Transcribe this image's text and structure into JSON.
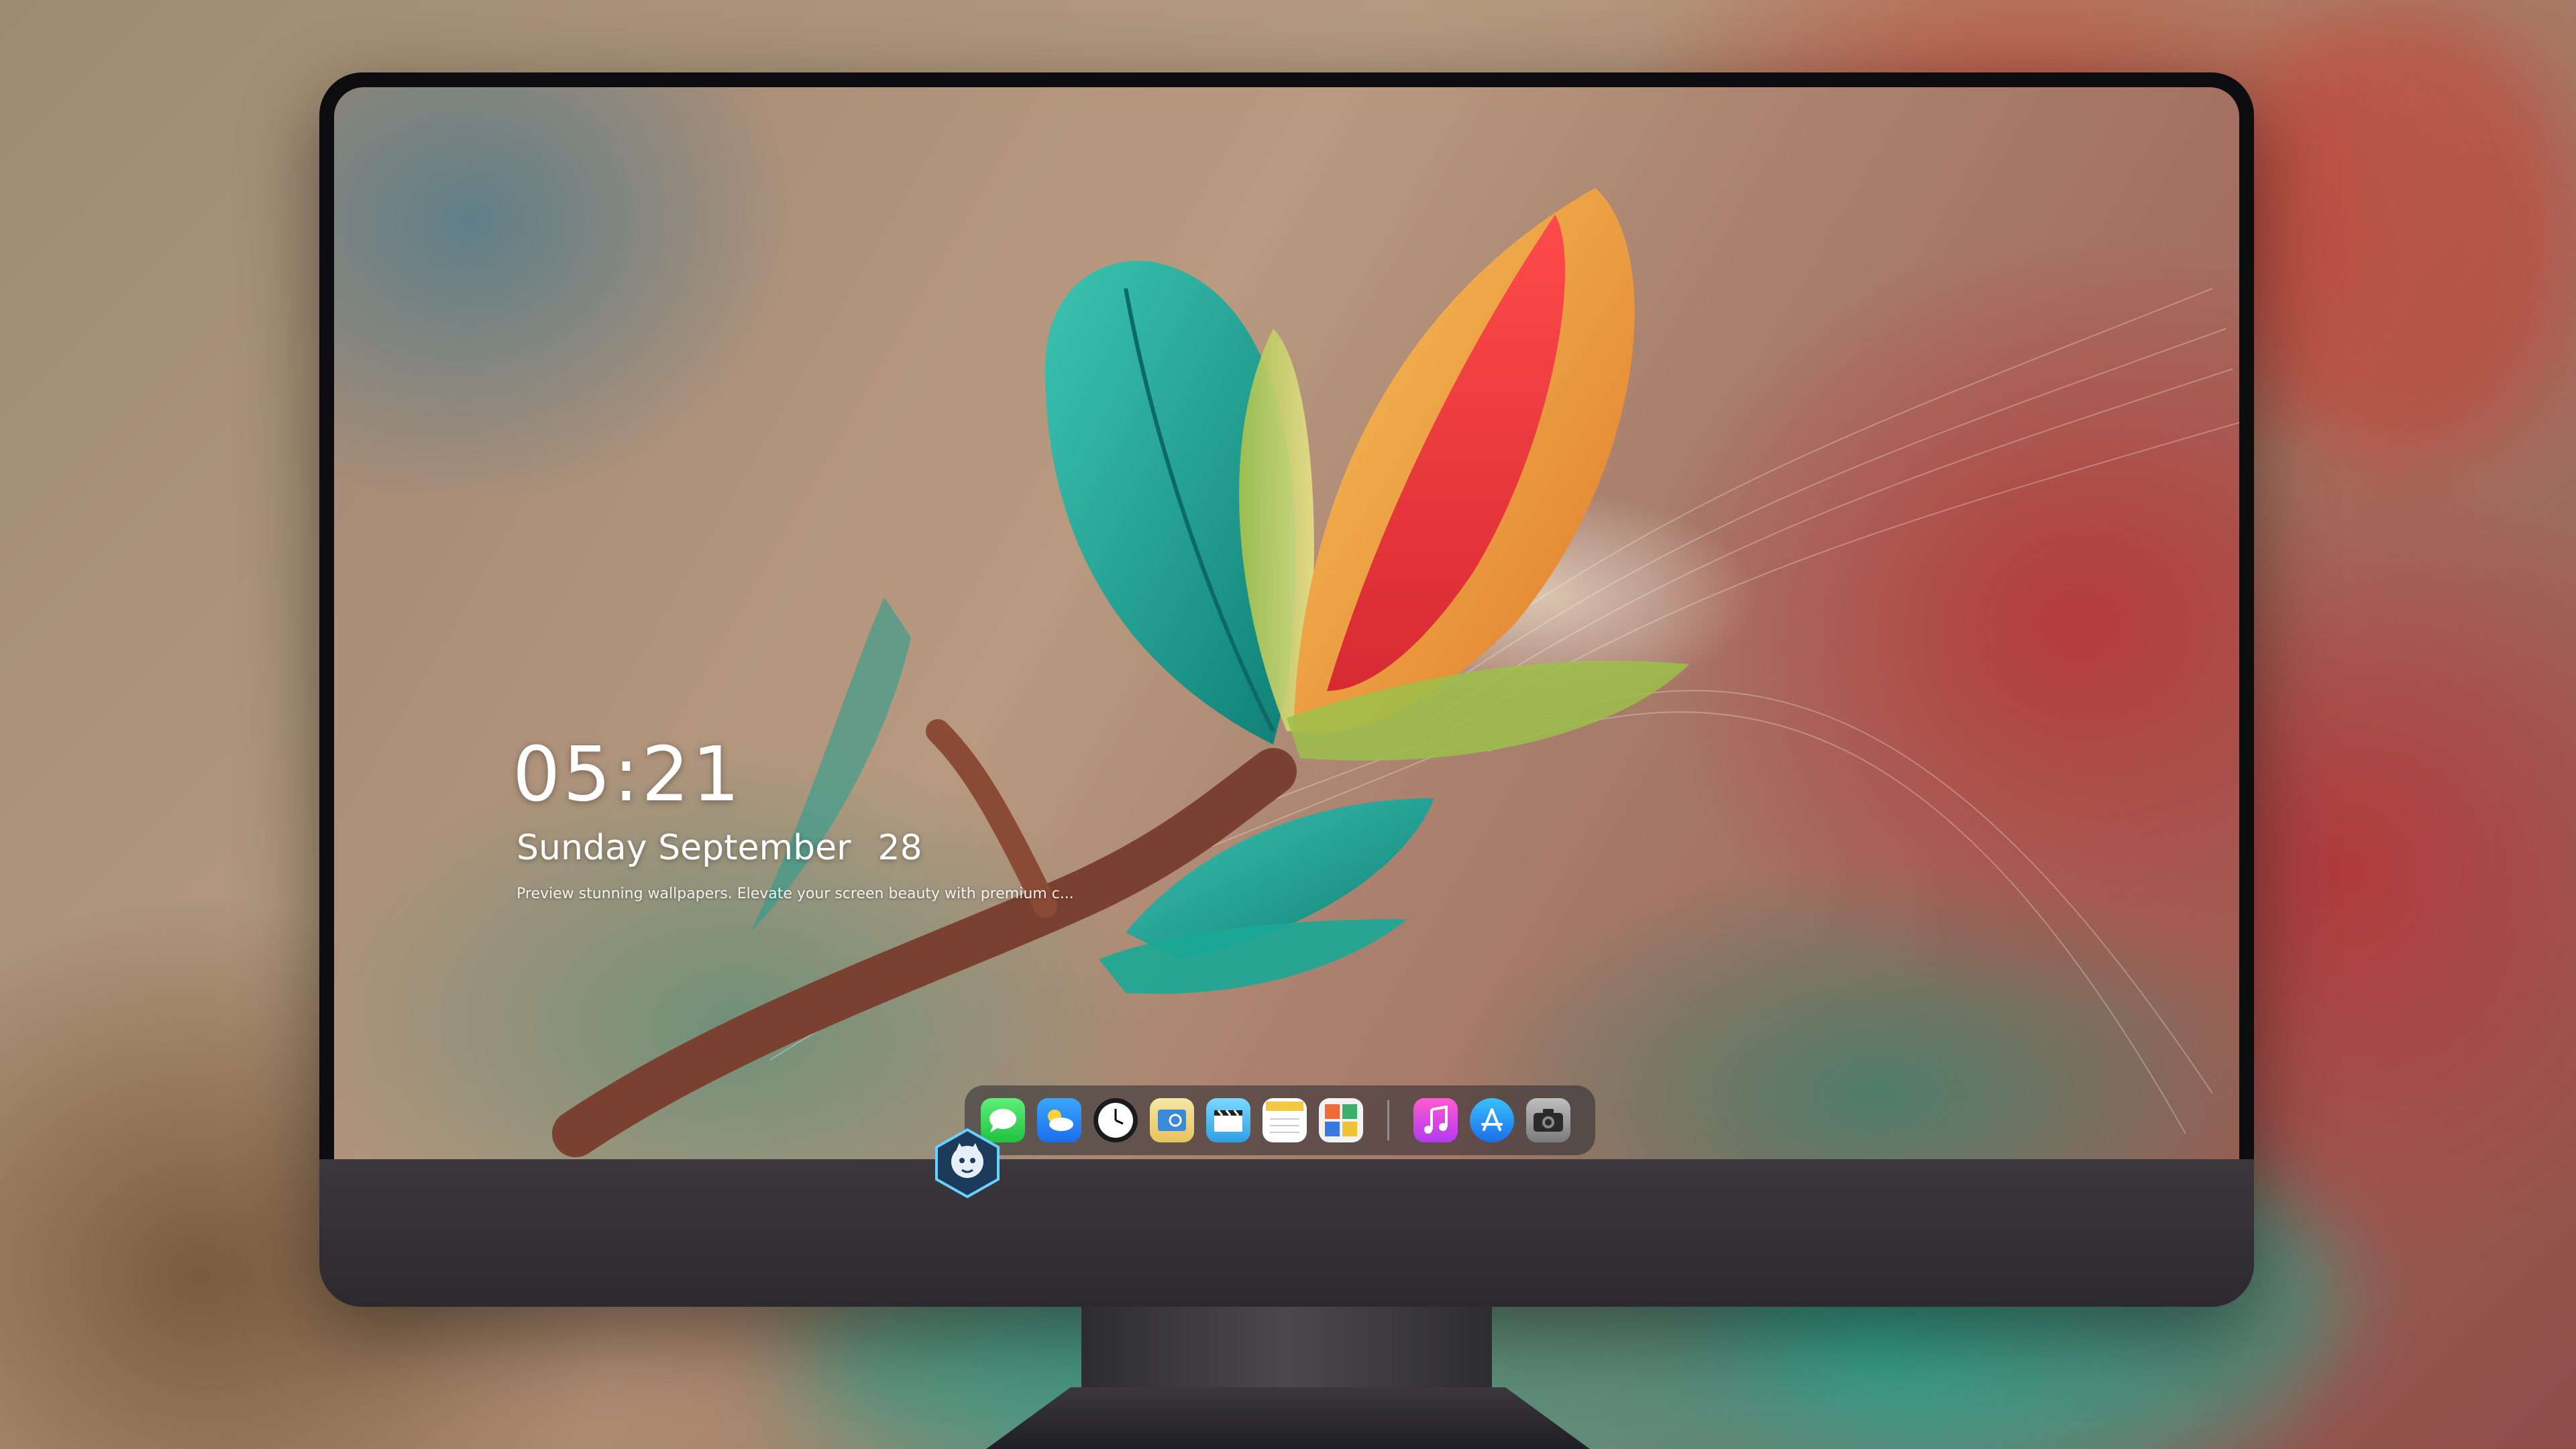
{
  "lock_screen": {
    "time": "05:21",
    "weekday_month": "Sunday September",
    "day": "28",
    "caption": "Preview stunning wallpapers. Elevate your screen beauty with premium c..."
  },
  "dock": {
    "items": [
      {
        "name": "Messages",
        "icon": "message-bubble-icon"
      },
      {
        "name": "Weather",
        "icon": "weather-icon"
      },
      {
        "name": "Clock",
        "icon": "clock-icon"
      },
      {
        "name": "Preview",
        "icon": "preview-icon"
      },
      {
        "name": "Clips",
        "icon": "clapperboard-icon"
      },
      {
        "name": "Notes",
        "icon": "notes-icon"
      },
      {
        "name": "Photos Collage",
        "icon": "photo-collage-icon"
      },
      {
        "name": "Music",
        "icon": "music-note-icon"
      },
      {
        "name": "App Store",
        "icon": "app-store-icon"
      },
      {
        "name": "Camera",
        "icon": "camera-icon"
      }
    ]
  },
  "colors": {
    "leaf_teal": "#1fa89a",
    "leaf_orange": "#f0a23a",
    "leaf_red": "#e83a3a",
    "monitor_bezel": "#0d0d10",
    "monitor_chin": "#333136"
  }
}
